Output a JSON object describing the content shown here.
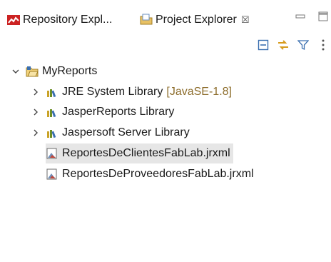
{
  "tabs": [
    {
      "label": "Repository Expl...",
      "icon": "repository-icon",
      "active": false
    },
    {
      "label": "Project Explorer",
      "icon": "project-explorer-icon",
      "active": true,
      "close_glyph": "☒"
    }
  ],
  "toolbar": {
    "buttons": [
      "collapse-all-icon",
      "link-with-editor-icon",
      "filter-icon",
      "view-menu-icon"
    ]
  },
  "tree": {
    "project": {
      "label": "MyReports",
      "expanded": true
    },
    "items": [
      {
        "label": "JRE System Library",
        "decoration": "[JavaSE-1.8]",
        "type": "library",
        "expandable": true
      },
      {
        "label": "JasperReports Library",
        "type": "library",
        "expandable": true
      },
      {
        "label": "Jaspersoft Server Library",
        "type": "library",
        "expandable": true
      },
      {
        "label": "ReportesDeClientesFabLab.jrxml",
        "type": "report",
        "selected": true
      },
      {
        "label": "ReportesDeProveedoresFabLab.jrxml",
        "type": "report",
        "selected": false
      }
    ]
  },
  "colors": {
    "selection": "#e6e6e6",
    "decoration_text": "#8d6d2c",
    "repository_icon_red": "#cc2222",
    "folder_blue": "#3a6fb0"
  }
}
